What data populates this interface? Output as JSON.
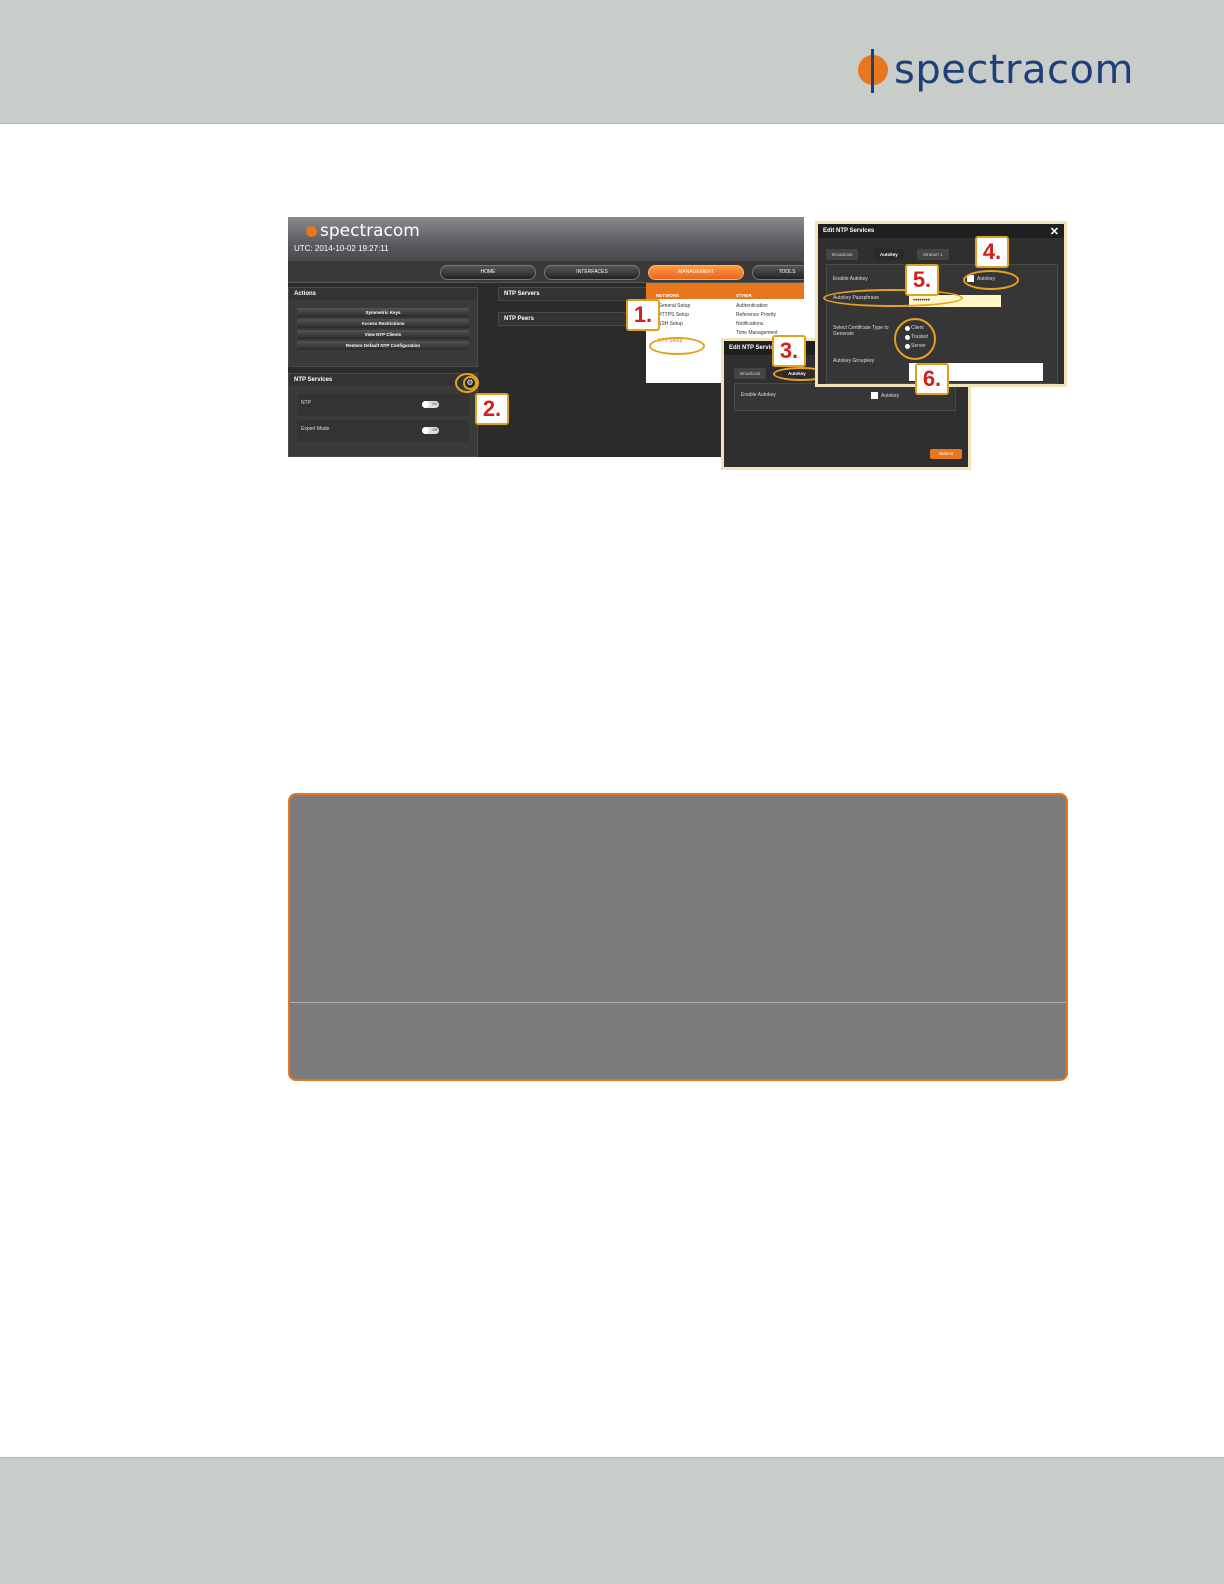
{
  "header": {
    "brand": "spectracom"
  },
  "screenshot": {
    "logo": "spectracom",
    "utc": "UTC: 2014-10-02 19:27:11",
    "nav": [
      "HOME",
      "INTERFACES",
      "MANAGEMENT",
      "TOOLS"
    ],
    "actions_title": "Actions",
    "actions": [
      "Symmetric Keys",
      "Access Restrictions",
      "View NTP Clients",
      "Restore Default NTP Configuration"
    ],
    "ntp_services_title": "NTP Services",
    "services": [
      {
        "label": "NTP",
        "toggle": "On"
      },
      {
        "label": "Expert Mode",
        "toggle": "Off"
      }
    ],
    "ntp_servers": "NTP Servers",
    "ntp_peers": "NTP Peers",
    "dropdown": {
      "network_header": "NETWORK",
      "other_header": "OTHER",
      "network_items": [
        "General Setup",
        "HTTPS Setup",
        "SSH Setup",
        "NTP Setup"
      ],
      "other_items": [
        "Authentication",
        "Reference Priority",
        "Notifications",
        "Time Management"
      ]
    }
  },
  "dialog_small": {
    "title": "Edit NTP Services",
    "tabs": [
      "Broadcast",
      "Autokey"
    ],
    "enable_label": "Enable Autokey",
    "checkbox_label": "Autokey",
    "submit": "Submit"
  },
  "dialog_large": {
    "title": "Edit NTP Services",
    "close": "✕",
    "tabs": [
      "Broadcast",
      "Autokey",
      "Stratum 1"
    ],
    "enable_label": "Enable Autokey",
    "checkbox_label": "Autokey",
    "passphrase_label": "Autokey Passphrase",
    "passphrase_value": "••••••••",
    "cert_label": "Select Certificate Type to Generate",
    "cert_options": [
      "Client",
      "Trusted",
      "Server"
    ],
    "groupkey_label": "Autokey Groupkey"
  },
  "callouts": [
    "1.",
    "2.",
    "3.",
    "4.",
    "5.",
    "6."
  ],
  "colors": {
    "accent": "#e8761d",
    "brand_blue": "#1e3f7a",
    "callout_red": "#d41e1e",
    "note_grey": "#7e7b7c",
    "band_grey": "#c9cdc9"
  }
}
